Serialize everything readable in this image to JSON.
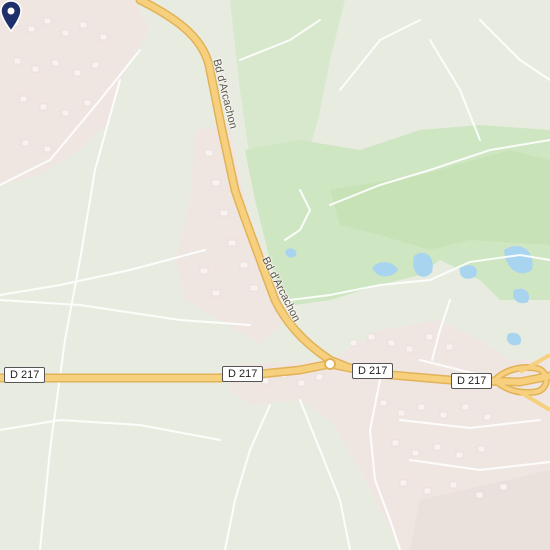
{
  "map": {
    "route_shields": [
      "D 217",
      "D 217",
      "D 217",
      "D 217"
    ],
    "street_labels": [
      "Bd d'Arcachon",
      "Bd d'Arcachon"
    ],
    "marker_icon": "location-pin-icon",
    "colors": {
      "background": "#e8ece0",
      "forest": "#cfe6c2",
      "residential": "#efe6e2",
      "building": "#f9f3ef",
      "major_road": "#f7d07e",
      "road_casing": "#e2b258",
      "minor_road": "#ffffff",
      "water": "#a9d4ef",
      "marker": "#1f2f6b"
    }
  }
}
